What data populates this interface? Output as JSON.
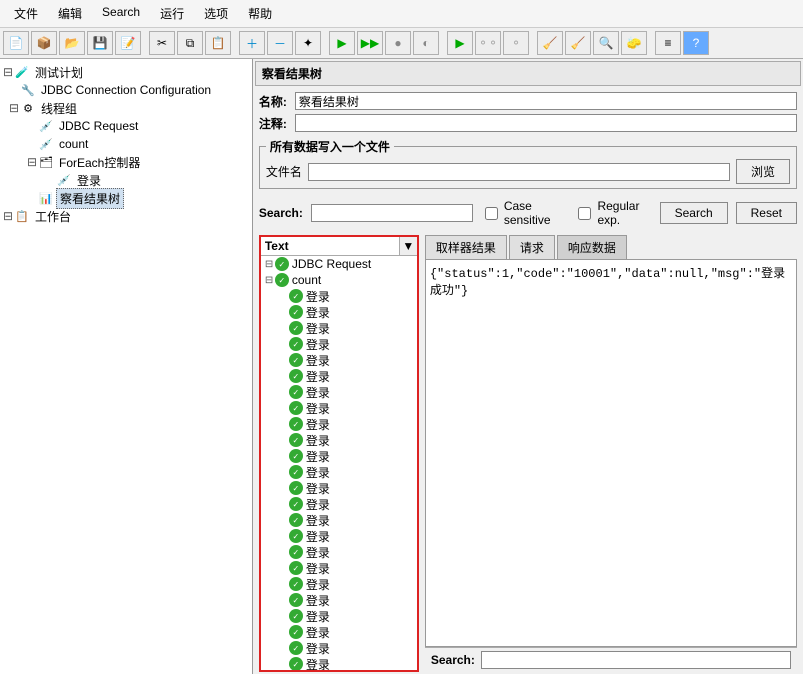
{
  "menu": {
    "file": "文件",
    "edit": "编辑",
    "search": "Search",
    "run": "运行",
    "options": "选项",
    "help": "帮助"
  },
  "tree": {
    "plan": "测试计划",
    "jdbc_conn": "JDBC Connection Configuration",
    "thread_group": "线程组",
    "jdbc_req": "JDBC Request",
    "count": "count",
    "foreach": "ForEach控制器",
    "login": "登录",
    "vrt": "察看结果树",
    "workbench": "工作台"
  },
  "panel": {
    "title": "察看结果树",
    "name_label": "名称:",
    "name_value": "察看结果树",
    "comment_label": "注释:",
    "write_group": "所有数据写入一个文件",
    "file_label": "文件名",
    "browse": "浏览"
  },
  "search": {
    "label": "Search:",
    "case": "Case sensitive",
    "regex": "Regular exp.",
    "btn_search": "Search",
    "btn_reset": "Reset"
  },
  "results": {
    "header": "Text",
    "items": [
      {
        "label": "JDBC Request",
        "indent": 0,
        "expand": true
      },
      {
        "label": "count",
        "indent": 0,
        "expand": true
      },
      {
        "label": "登录",
        "indent": 1
      },
      {
        "label": "登录",
        "indent": 1
      },
      {
        "label": "登录",
        "indent": 1
      },
      {
        "label": "登录",
        "indent": 1
      },
      {
        "label": "登录",
        "indent": 1
      },
      {
        "label": "登录",
        "indent": 1
      },
      {
        "label": "登录",
        "indent": 1
      },
      {
        "label": "登录",
        "indent": 1
      },
      {
        "label": "登录",
        "indent": 1
      },
      {
        "label": "登录",
        "indent": 1
      },
      {
        "label": "登录",
        "indent": 1
      },
      {
        "label": "登录",
        "indent": 1
      },
      {
        "label": "登录",
        "indent": 1
      },
      {
        "label": "登录",
        "indent": 1
      },
      {
        "label": "登录",
        "indent": 1
      },
      {
        "label": "登录",
        "indent": 1
      },
      {
        "label": "登录",
        "indent": 1
      },
      {
        "label": "登录",
        "indent": 1
      },
      {
        "label": "登录",
        "indent": 1
      },
      {
        "label": "登录",
        "indent": 1
      },
      {
        "label": "登录",
        "indent": 1
      },
      {
        "label": "登录",
        "indent": 1
      },
      {
        "label": "登录",
        "indent": 1
      },
      {
        "label": "登录",
        "indent": 1
      }
    ]
  },
  "tabs": {
    "sampler": "取样器结果",
    "request": "请求",
    "response": "响应数据"
  },
  "response_body": "{\"status\":1,\"code\":\"10001\",\"data\":null,\"msg\":\"登录成功\"}",
  "bottom": {
    "search": "Search:"
  }
}
